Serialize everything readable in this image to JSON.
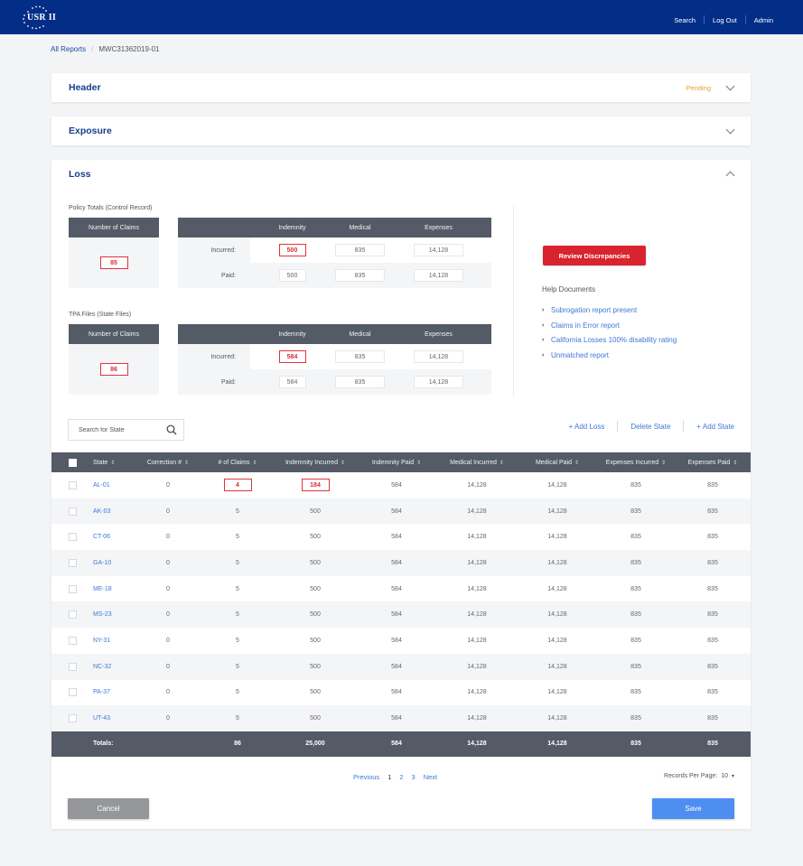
{
  "app": {
    "logo_text": "USR II"
  },
  "topnav": {
    "search": "Search",
    "logout": "Log Out",
    "admin": "Admin"
  },
  "breadcrumb": {
    "root": "All Reports",
    "separator": "/",
    "current": "MWC31362019-01"
  },
  "panels": {
    "header": {
      "title": "Header",
      "status": "Pending"
    },
    "exposure": {
      "title": "Exposure"
    },
    "loss": {
      "title": "Loss"
    }
  },
  "colors": {
    "brand": "#032d87",
    "error": "#d9232e",
    "link": "#3c78d8",
    "pending": "#e8a030",
    "table_header": "#545b66"
  },
  "policy_totals": {
    "label": "Policy Totals (Control Record)",
    "claims_header": "Number of Claims",
    "claims": "85",
    "columns": [
      "Indemnity",
      "Medical",
      "Expenses"
    ],
    "incurred": {
      "label": "Incurred:",
      "indemnity": "500",
      "medical": "835",
      "expenses": "14,128"
    },
    "paid": {
      "label": "Paid:",
      "indemnity": "500",
      "medical": "835",
      "expenses": "14,128"
    }
  },
  "tpa_files": {
    "label": "TPA Files (State Files)",
    "claims_header": "Number of Claims",
    "claims": "86",
    "columns": [
      "Indemnity",
      "Medical",
      "Expenses"
    ],
    "incurred": {
      "label": "Incurred:",
      "indemnity": "584",
      "medical": "835",
      "expenses": "14,128"
    },
    "paid": {
      "label": "Paid:",
      "indemnity": "584",
      "medical": "835",
      "expenses": "14,128"
    }
  },
  "review_button": "Review Discrepancies",
  "help": {
    "title": "Help Documents",
    "items": [
      "Subrogation report present",
      "Claims in Error report",
      "California Losses 100% disability rating",
      "Unmatched report"
    ]
  },
  "search": {
    "placeholder": "Search for State"
  },
  "actions": {
    "add_loss": "+ Add Loss",
    "delete_state": "Delete State",
    "add_state": "+ Add State"
  },
  "table": {
    "columns": [
      "State",
      "Correction #",
      "# of Claims",
      "Indemnity Incurred",
      "Indemnity Paid",
      "Medical Incurred",
      "Medical Paid",
      "Expenses Incurred",
      "Expenses Paid"
    ],
    "rows": [
      {
        "state": "AL-01",
        "correction": "0",
        "claims": "4",
        "ind_inc": "184",
        "ind_paid": "584",
        "med_inc": "14,128",
        "med_paid": "14,128",
        "exp_inc": "835",
        "exp_paid": "835",
        "error": true
      },
      {
        "state": "AK-03",
        "correction": "0",
        "claims": "5",
        "ind_inc": "500",
        "ind_paid": "584",
        "med_inc": "14,128",
        "med_paid": "14,128",
        "exp_inc": "835",
        "exp_paid": "835"
      },
      {
        "state": "CT-06",
        "correction": "0",
        "claims": "5",
        "ind_inc": "500",
        "ind_paid": "584",
        "med_inc": "14,128",
        "med_paid": "14,128",
        "exp_inc": "835",
        "exp_paid": "835"
      },
      {
        "state": "GA-10",
        "correction": "0",
        "claims": "5",
        "ind_inc": "500",
        "ind_paid": "584",
        "med_inc": "14,128",
        "med_paid": "14,128",
        "exp_inc": "835",
        "exp_paid": "835"
      },
      {
        "state": "ME-18",
        "correction": "0",
        "claims": "5",
        "ind_inc": "500",
        "ind_paid": "584",
        "med_inc": "14,128",
        "med_paid": "14,128",
        "exp_inc": "835",
        "exp_paid": "835"
      },
      {
        "state": "MS-23",
        "correction": "0",
        "claims": "5",
        "ind_inc": "500",
        "ind_paid": "584",
        "med_inc": "14,128",
        "med_paid": "14,128",
        "exp_inc": "835",
        "exp_paid": "835"
      },
      {
        "state": "NY-31",
        "correction": "0",
        "claims": "5",
        "ind_inc": "500",
        "ind_paid": "584",
        "med_inc": "14,128",
        "med_paid": "14,128",
        "exp_inc": "835",
        "exp_paid": "835"
      },
      {
        "state": "NC-32",
        "correction": "0",
        "claims": "5",
        "ind_inc": "500",
        "ind_paid": "584",
        "med_inc": "14,128",
        "med_paid": "14,128",
        "exp_inc": "835",
        "exp_paid": "835"
      },
      {
        "state": "PA-37",
        "correction": "0",
        "claims": "5",
        "ind_inc": "500",
        "ind_paid": "584",
        "med_inc": "14,128",
        "med_paid": "14,128",
        "exp_inc": "835",
        "exp_paid": "835"
      },
      {
        "state": "UT-43",
        "correction": "0",
        "claims": "5",
        "ind_inc": "500",
        "ind_paid": "584",
        "med_inc": "14,128",
        "med_paid": "14,128",
        "exp_inc": "835",
        "exp_paid": "835"
      }
    ],
    "totals": {
      "label": "Totals:",
      "claims": "86",
      "ind_inc": "25,000",
      "ind_paid": "584",
      "med_inc": "14,128",
      "med_paid": "14,128",
      "exp_inc": "835",
      "exp_paid": "835"
    }
  },
  "pagination": {
    "previous": "Previous",
    "pages": [
      "1",
      "2",
      "3"
    ],
    "current": "1",
    "next": "Next",
    "records_label": "Records Per Page:",
    "records_value": "10"
  },
  "footer": {
    "cancel": "Cancel",
    "save": "Save"
  }
}
